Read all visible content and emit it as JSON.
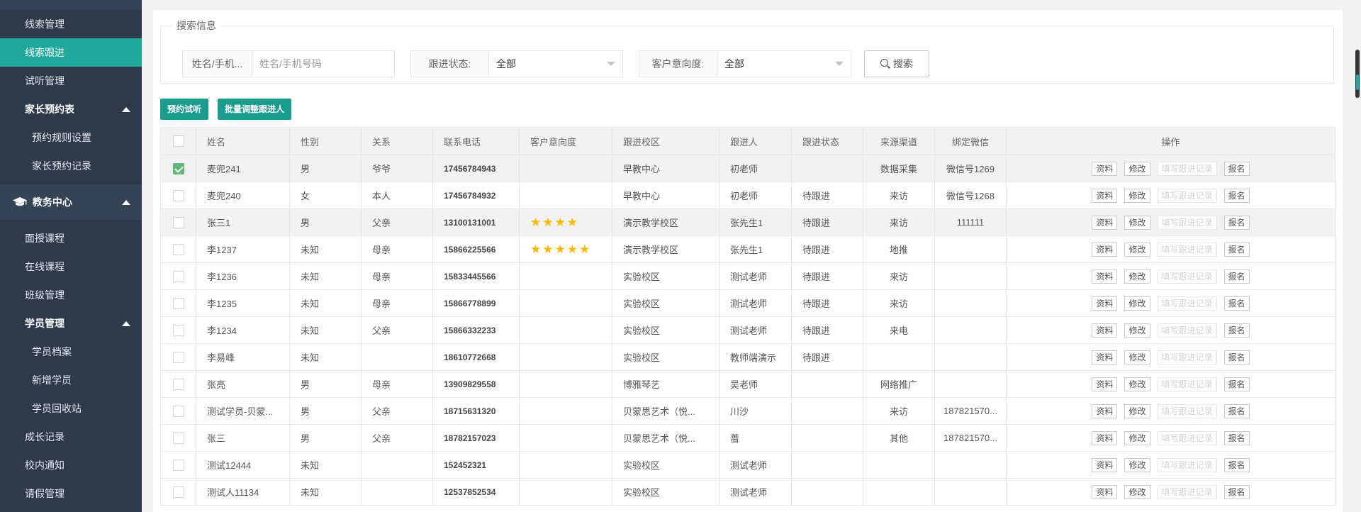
{
  "sidebar": {
    "items_top": [
      {
        "label": "线索管理",
        "active": false
      },
      {
        "label": "线索跟进",
        "active": true
      },
      {
        "label": "试听管理",
        "active": false
      }
    ],
    "parent_group": {
      "label": "家长预约表",
      "children": [
        "预约规则设置",
        "家长预约记录"
      ]
    },
    "section": {
      "label": "教务中心",
      "icon": "graduation-cap-icon"
    },
    "section_items": [
      "面授课程",
      "在线课程",
      "班级管理"
    ],
    "student_group": {
      "label": "学员管理",
      "children": [
        "学员档案",
        "新增学员",
        "学员回收站"
      ]
    },
    "items_bottom": [
      "成长记录",
      "校内通知",
      "请假管理"
    ]
  },
  "search": {
    "legend": "搜索信息",
    "name_label": "姓名/手机...",
    "name_placeholder": "姓名/手机号码",
    "status_label": "跟进状态:",
    "status_value": "全部",
    "intent_label": "客户意向度:",
    "intent_value": "全部",
    "button": "搜索"
  },
  "toolbar": {
    "book_trial": "预约试听",
    "batch_assign": "批量调整跟进人"
  },
  "table": {
    "headers": [
      "姓名",
      "性别",
      "关系",
      "联系电话",
      "客户意向度",
      "跟进校区",
      "跟进人",
      "跟进状态",
      "来源渠道",
      "绑定微信",
      "操作"
    ],
    "actions": [
      "资料",
      "修改",
      "填写跟进记录",
      "报名"
    ],
    "rows": [
      {
        "name": "麦兜241",
        "gender": "男",
        "relation": "爷爷",
        "phone": "17456784943",
        "stars": "",
        "campus": "早教中心",
        "follower": "初老师",
        "status": "",
        "source": "数据采集",
        "wechat": "微信号1269",
        "checked": true,
        "gray": true
      },
      {
        "name": "麦兜240",
        "gender": "女",
        "relation": "本人",
        "phone": "17456784932",
        "stars": "",
        "campus": "早教中心",
        "follower": "初老师",
        "status": "待跟进",
        "source": "来访",
        "wechat": "微信号1268",
        "checked": false,
        "gray": false
      },
      {
        "name": "张三1",
        "gender": "男",
        "relation": "父亲",
        "phone": "13100131001",
        "stars": "★★★★",
        "campus": "演示教学校区",
        "follower": "张先生1",
        "status": "待跟进",
        "source": "来访",
        "wechat": "111111",
        "checked": false,
        "gray": true
      },
      {
        "name": "李1237",
        "gender": "未知",
        "relation": "母亲",
        "phone": "15866225566",
        "stars": "★★★★★",
        "campus": "演示教学校区",
        "follower": "张先生1",
        "status": "待跟进",
        "source": "地推",
        "wechat": "",
        "checked": false,
        "gray": false
      },
      {
        "name": "李1236",
        "gender": "未知",
        "relation": "母亲",
        "phone": "15833445566",
        "stars": "",
        "campus": "实验校区",
        "follower": "测试老师",
        "status": "待跟进",
        "source": "来访",
        "wechat": "",
        "checked": false,
        "gray": false
      },
      {
        "name": "李1235",
        "gender": "未知",
        "relation": "母亲",
        "phone": "15866778899",
        "stars": "",
        "campus": "实验校区",
        "follower": "测试老师",
        "status": "待跟进",
        "source": "来访",
        "wechat": "",
        "checked": false,
        "gray": false
      },
      {
        "name": "李1234",
        "gender": "未知",
        "relation": "父亲",
        "phone": "15866332233",
        "stars": "",
        "campus": "实验校区",
        "follower": "测试老师",
        "status": "待跟进",
        "source": "来电",
        "wechat": "",
        "checked": false,
        "gray": false
      },
      {
        "name": "李易峰",
        "gender": "未知",
        "relation": "",
        "phone": "18610772668",
        "stars": "",
        "campus": "实验校区",
        "follower": "教师端演示",
        "status": "待跟进",
        "source": "",
        "wechat": "",
        "checked": false,
        "gray": false
      },
      {
        "name": "张亮",
        "gender": "男",
        "relation": "母亲",
        "phone": "13909829558",
        "stars": "",
        "campus": "博雅琴艺",
        "follower": "吴老师",
        "status": "",
        "source": "网络推广",
        "wechat": "",
        "checked": false,
        "gray": false
      },
      {
        "name": "测试学员-贝蒙...",
        "gender": "男",
        "relation": "父亲",
        "phone": "18715631320",
        "stars": "",
        "campus": "贝蒙思艺术（悦...",
        "follower": "川沙",
        "status": "",
        "source": "来访",
        "wechat": "187821570...",
        "checked": false,
        "gray": false
      },
      {
        "name": "张三",
        "gender": "男",
        "relation": "父亲",
        "phone": "18782157023",
        "stars": "",
        "campus": "贝蒙思艺术（悦...",
        "follower": "蔷",
        "status": "",
        "source": "其他",
        "wechat": "187821570...",
        "checked": false,
        "gray": false
      },
      {
        "name": "测试12444",
        "gender": "未知",
        "relation": "",
        "phone": "152452321",
        "stars": "",
        "campus": "实验校区",
        "follower": "测试老师",
        "status": "",
        "source": "",
        "wechat": "",
        "checked": false,
        "gray": false
      },
      {
        "name": "测试人11134",
        "gender": "未知",
        "relation": "",
        "phone": "12537852534",
        "stars": "",
        "campus": "实验校区",
        "follower": "测试老师",
        "status": "",
        "source": "",
        "wechat": "",
        "checked": false,
        "gray": false
      }
    ]
  },
  "colors": {
    "sidebar_bg": "#2c3a4b",
    "active": "#1fa99a",
    "primary_btn": "#1a9d8f",
    "star": "#ffb800"
  }
}
